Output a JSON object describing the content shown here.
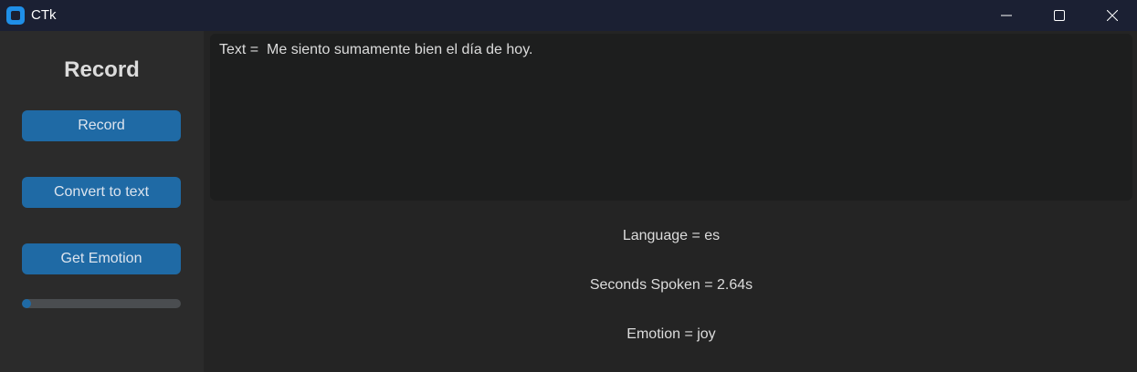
{
  "window": {
    "title": "CTk",
    "controls": [
      "minimize-icon",
      "maximize-icon",
      "close-icon"
    ]
  },
  "sidebar": {
    "title": "Record",
    "buttons": {
      "record": "Record",
      "convert": "Convert to text",
      "emotion": "Get Emotion"
    },
    "progress": 0.06
  },
  "main": {
    "text_output": "Text =  Me siento sumamente bien el día de hoy.",
    "language": "Language = es",
    "seconds_spoken": "Seconds Spoken = 2.64s",
    "emotion": "Emotion = joy"
  },
  "colors": {
    "accent": "#1f6aa5",
    "titlebar": "#1b2033",
    "sidebar": "#2b2b2b",
    "background": "#242424",
    "textbox": "#1d1e1e"
  }
}
